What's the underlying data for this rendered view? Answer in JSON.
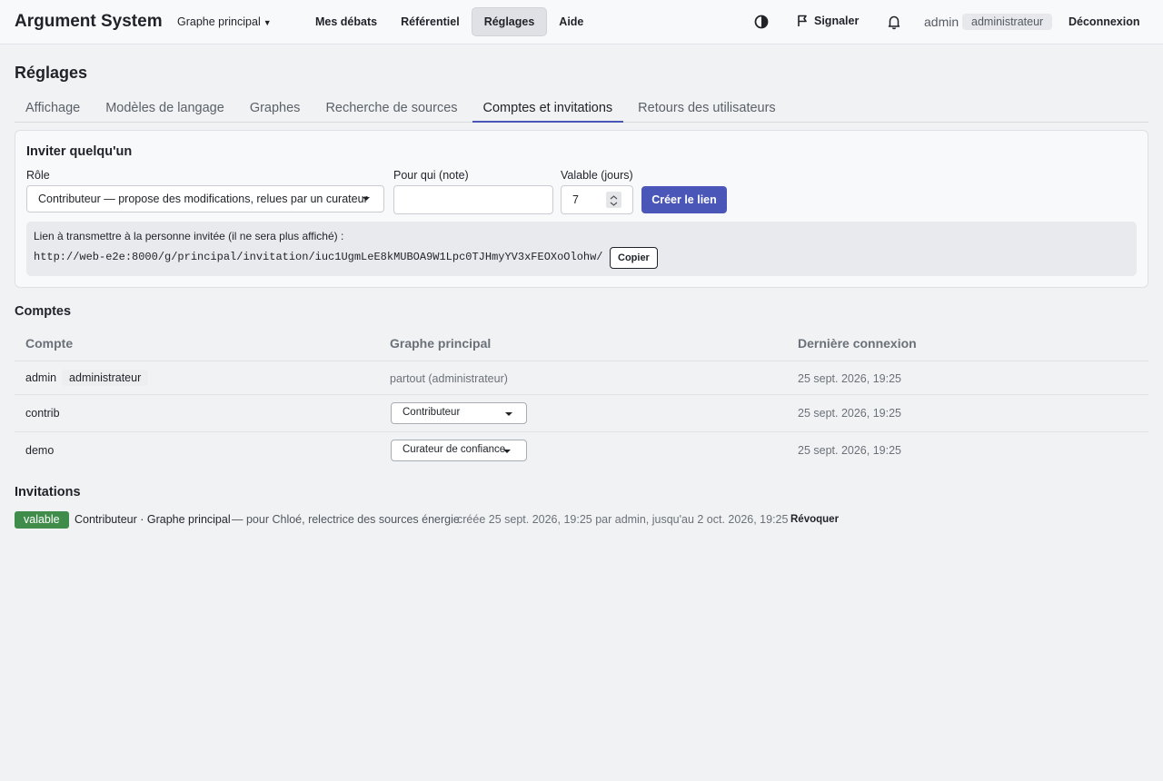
{
  "header": {
    "app_title": "Argument System",
    "graph_switch": "Graphe principal",
    "nav": [
      "Mes débats",
      "Référentiel",
      "Réglages",
      "Aide"
    ],
    "active_nav": "Réglages",
    "theme_icon": "contrast-icon",
    "report_label": "Signaler",
    "user": "admin",
    "user_role": "administrateur",
    "logout": "Déconnexion"
  },
  "page": {
    "title": "Réglages",
    "tabs": [
      "Affichage",
      "Modèles de langage",
      "Graphes",
      "Recherche de sources",
      "Comptes et invitations",
      "Retours des utilisateurs"
    ],
    "active_tab": "Comptes et invitations"
  },
  "invite": {
    "title": "Inviter quelqu'un",
    "role_label": "Rôle",
    "role_value": "Contributeur — propose des modifications, relues par un curateur",
    "note_label": "Pour qui (note)",
    "note_value": "",
    "days_label": "Valable (jours)",
    "days_value": "7",
    "create_button": "Créer le lien",
    "link_label": "Lien à transmettre à la personne invitée (il ne sera plus affiché) :",
    "link_url": "http://web-e2e:8000/g/principal/invitation/iuc1UgmLeE8kMUBOA9W1Lpc0TJHmyYV3xFEOXoOlohw/",
    "copy_button": "Copier"
  },
  "accounts": {
    "title": "Comptes",
    "headers": [
      "Compte",
      "Graphe principal",
      "Dernière connexion"
    ],
    "rows": [
      {
        "name": "admin",
        "badge": "administrateur",
        "graph": "partout (administrateur)",
        "last": "25 sept. 2026, 19:25"
      },
      {
        "name": "contrib",
        "graph": "Contributeur",
        "last": "25 sept. 2026, 19:25"
      },
      {
        "name": "demo",
        "graph": "Curateur de confiance",
        "last": "25 sept. 2026, 19:25"
      }
    ]
  },
  "invitations": {
    "title": "Invitations",
    "items": [
      {
        "status": "valable",
        "role_graph": "Contributeur · Graphe principal",
        "note": "— pour Chloé, relectrice des sources énergie",
        "meta": "créée 25 sept. 2026, 19:25 par admin, jusqu'au 2 oct. 2026, 19:25",
        "revoke": "Révoquer"
      }
    ]
  },
  "colors": {
    "accent": "#4a56b8",
    "valid": "#3f8c4b"
  }
}
